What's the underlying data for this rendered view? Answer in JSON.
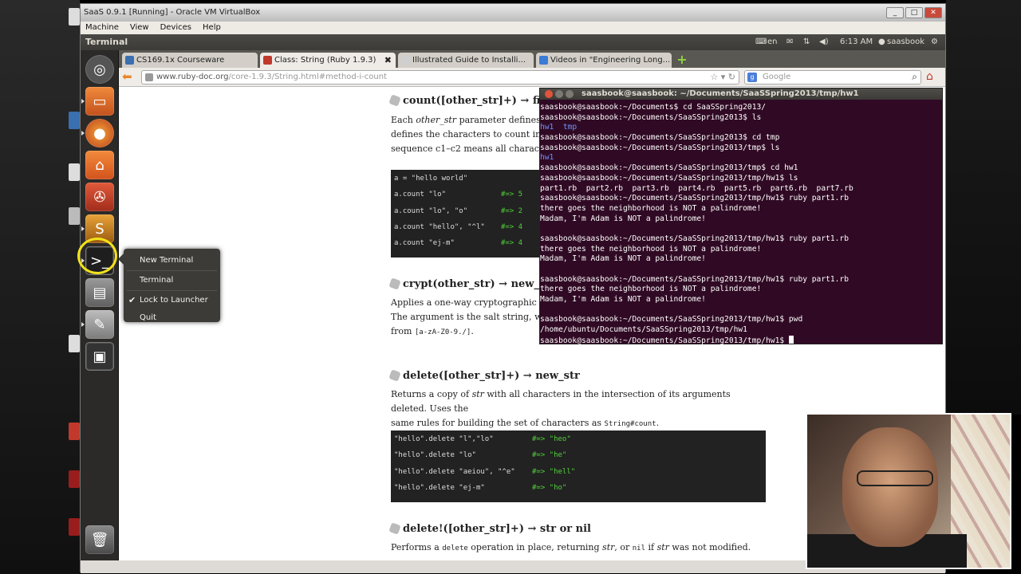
{
  "vbox": {
    "title": "SaaS 0.9.1 [Running] - Oracle VM VirtualBox",
    "menu": [
      "Machine",
      "View",
      "Devices",
      "Help"
    ]
  },
  "top_panel": {
    "title": "Terminal",
    "lang": "en",
    "time": "6:13 AM",
    "user": "saasbook"
  },
  "context_menu": {
    "items": [
      "New Terminal",
      "Terminal",
      "Lock to Launcher",
      "Quit"
    ],
    "checked_item": "Lock to Launcher"
  },
  "browser": {
    "tabs": [
      {
        "label": "CS169.1x Courseware",
        "active": false,
        "color": "#3a6fb0"
      },
      {
        "label": "Class: String (Ruby 1.9.3)",
        "active": true,
        "color": "#c0392b"
      },
      {
        "label": "Illustrated Guide to Installi...",
        "active": false,
        "color": "#cfcfcf"
      },
      {
        "label": "Videos in \"Engineering Long...",
        "active": false,
        "color": "#3a7bd5"
      }
    ],
    "url_host": "www.ruby-doc.org",
    "url_path": "/core-1.9.3/String.html#method-i-count",
    "search_engine_badge": "g",
    "search_placeholder": "Google"
  },
  "doc": {
    "count": {
      "sig": "count([other_str]+) → fixn",
      "text": [
        [
          "Each ",
          "other_str",
          " parameter defines a se"
        ],
        [
          "defines the characters to count in ",
          "str",
          ". "
        ],
        [
          "sequence c1–c2 means all characters",
          "",
          ""
        ]
      ],
      "code": [
        {
          "l": "a = \"hello world\"",
          "r": ""
        },
        {
          "l": "a.count \"lo\"",
          "r": "#=> 5"
        },
        {
          "l": "a.count \"lo\", \"o\"",
          "r": "#=> 2"
        },
        {
          "l": "a.count \"hello\", \"^l\"",
          "r": "#=> 4"
        },
        {
          "l": "a.count \"ej-m\"",
          "r": "#=> 4"
        }
      ]
    },
    "crypt": {
      "sig": "crypt(other_str) → new_s",
      "line1": "Applies a one-way cryptographic has",
      "line2": "The argument is the salt string, which",
      "line3_prefix": "from ",
      "line3_code": "[a-zA-Z0-9./]",
      "line3_suffix": "."
    },
    "delete": {
      "sig": "delete([other_str]+) → new_str",
      "line1_a": "Returns a copy of ",
      "line1_em": "str",
      "line1_b": " with all characters in the intersection of its arguments deleted. Uses the",
      "line2_a": "same rules for building the set of characters as ",
      "line2_code": "String#count",
      "line2_b": ".",
      "code": [
        {
          "l": "\"hello\".delete \"l\",\"lo\"",
          "r": "#=> \"heo\""
        },
        {
          "l": "\"hello\".delete \"lo\"",
          "r": "#=> \"he\""
        },
        {
          "l": "\"hello\".delete \"aeiou\", \"^e\"",
          "r": "#=> \"hell\""
        },
        {
          "l": "\"hello\".delete \"ej-m\"",
          "r": "#=> \"ho\""
        }
      ]
    },
    "delete_bang": {
      "sig": "delete!([other_str]+) → str or nil",
      "line_a": "Performs a ",
      "line_code": "delete",
      "line_b": " operation in place, returning ",
      "line_em": "str",
      "line_c": ", or ",
      "line_code2": "nil",
      "line_d": " if ",
      "line_em2": "str",
      "line_e": " was not modified."
    }
  },
  "terminal": {
    "title": "saasbook@saasbook: ~/Documents/SaaSSpring2013/tmp/hw1",
    "lines": [
      {
        "t": "saasbook@saasbook:~/Documents$ cd SaaSSpring2013/",
        "c": "w"
      },
      {
        "t": "saasbook@saasbook:~/Documents/SaaSSpring2013$ ls",
        "c": "w"
      },
      {
        "t": "hw1  tmp",
        "c": "b"
      },
      {
        "t": "saasbook@saasbook:~/Documents/SaaSSpring2013$ cd tmp",
        "c": "w"
      },
      {
        "t": "saasbook@saasbook:~/Documents/SaaSSpring2013/tmp$ ls",
        "c": "w"
      },
      {
        "t": "hw1",
        "c": "b"
      },
      {
        "t": "saasbook@saasbook:~/Documents/SaaSSpring2013/tmp$ cd hw1",
        "c": "w"
      },
      {
        "t": "saasbook@saasbook:~/Documents/SaaSSpring2013/tmp/hw1$ ls",
        "c": "w"
      },
      {
        "t": "part1.rb  part2.rb  part3.rb  part4.rb  part5.rb  part6.rb  part7.rb",
        "c": "w"
      },
      {
        "t": "saasbook@saasbook:~/Documents/SaaSSpring2013/tmp/hw1$ ruby part1.rb",
        "c": "w"
      },
      {
        "t": "there goes the neighborhood is NOT a palindrome!",
        "c": "w"
      },
      {
        "t": "Madam, I'm Adam is NOT a palindrome!",
        "c": "w"
      },
      {
        "t": "",
        "c": "w"
      },
      {
        "t": "saasbook@saasbook:~/Documents/SaaSSpring2013/tmp/hw1$ ruby part1.rb",
        "c": "w"
      },
      {
        "t": "there goes the neighborhood is NOT a palindrome!",
        "c": "w"
      },
      {
        "t": "Madam, I'm Adam is NOT a palindrome!",
        "c": "w"
      },
      {
        "t": "",
        "c": "w"
      },
      {
        "t": "saasbook@saasbook:~/Documents/SaaSSpring2013/tmp/hw1$ ruby part1.rb",
        "c": "w"
      },
      {
        "t": "there goes the neighborhood is NOT a palindrome!",
        "c": "w"
      },
      {
        "t": "Madam, I'm Adam is NOT a palindrome!",
        "c": "w"
      },
      {
        "t": "",
        "c": "w"
      },
      {
        "t": "saasbook@saasbook:~/Documents/SaaSSpring2013/tmp/hw1$ pwd",
        "c": "w"
      },
      {
        "t": "/home/ubuntu/Documents/SaaSSpring2013/tmp/hw1",
        "c": "w"
      },
      {
        "t": "saasbook@saasbook:~/Documents/SaaSSpring2013/tmp/hw1$ ",
        "c": "w",
        "cursor": true
      }
    ]
  }
}
